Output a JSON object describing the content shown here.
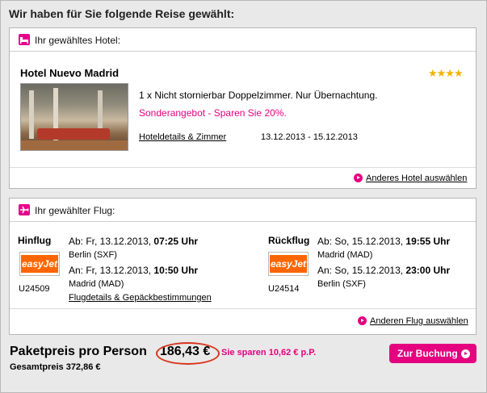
{
  "header": {
    "title": "Wir haben für Sie folgende Reise gewählt:"
  },
  "hotel": {
    "section_label": "Ihr gewähltes Hotel:",
    "name": "Hotel Nuevo Madrid",
    "stars": "★★★★",
    "room": "1 x Nicht stornierbar Doppelzimmer. Nur Übernachtung.",
    "offer": "Sonderangebot - Sparen Sie 20%.",
    "details_link": "Hoteldetails & Zimmer",
    "dates": "13.12.2013 - 15.12.2013",
    "change_link": "Anderes Hotel auswählen"
  },
  "flight": {
    "section_label": "Ihr gewählter Flug:",
    "outbound": {
      "label": "Hinflug",
      "dep_prefix": "Ab: Fr, 13.12.2013, ",
      "dep_time": "07:25 Uhr",
      "dep_airport": "Berlin (SXF)",
      "arr_prefix": "An: Fr, 13.12.2013, ",
      "arr_time": "10:50 Uhr",
      "arr_airport": "Madrid (MAD)",
      "airline": "easyJet",
      "flight_no": "U24509",
      "details_link": "Flugdetails & Gepäckbestimmungen"
    },
    "return": {
      "label": "Rückflug",
      "dep_prefix": "Ab: So, 15.12.2013, ",
      "dep_time": "19:55 Uhr",
      "dep_airport": "Madrid (MAD)",
      "arr_prefix": "An: So, 15.12.2013, ",
      "arr_time": "23:00 Uhr",
      "arr_airport": "Berlin (SXF)",
      "airline": "easyJet",
      "flight_no": "U24514"
    },
    "change_link": "Anderen Flug auswählen"
  },
  "summary": {
    "label": "Paketpreis pro Person",
    "price": "186,43 €",
    "savings": "Sie sparen 10,62 € p.P.",
    "total": "Gesamtpreis 372,86 €",
    "book_button": "Zur Buchung"
  },
  "colors": {
    "accent": "#e4007f",
    "star": "#f0b400",
    "easyjet": "#ff6600",
    "highlight_circle": "#d8341c"
  }
}
